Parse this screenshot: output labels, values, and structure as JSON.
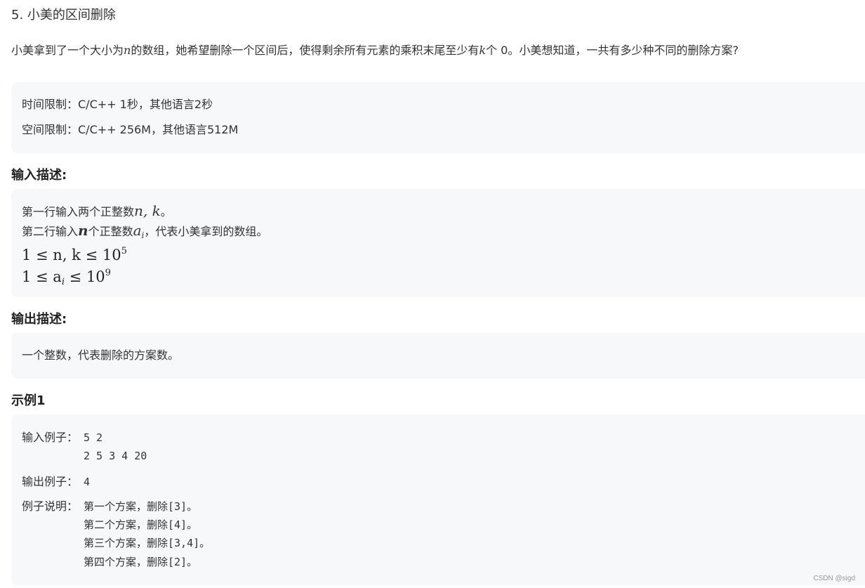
{
  "problem": {
    "title": "5. 小美的区间删除",
    "description": {
      "part1": "小美拿到了一个大小为",
      "var_n": "n",
      "part2": "的数组，她希望删除一个区间后，使得剩余所有元素的乘积末尾至少有",
      "var_k": "k",
      "part3": "个 0。小美想知道，一共有多少种不同的删除方案?"
    }
  },
  "limits": {
    "time": "时间限制：C/C++ 1秒，其他语言2秒",
    "memory": "空间限制：C/C++ 256M，其他语言512M"
  },
  "input_section": {
    "heading": "输入描述:",
    "line1_text": "第一行输入两个正整数",
    "line1_math": "n, k",
    "line1_end": "。",
    "line2_text": "第二行输入",
    "line2_math_n": "n",
    "line2_mid": "个正整数",
    "line2_math_a": "a",
    "line2_sub": "i",
    "line2_end": "，代表小美拿到的数组。",
    "constraint1": "1 ≤ n, k ≤ 10",
    "constraint1_exp": "5",
    "constraint2_left": "1 ≤ a",
    "constraint2_sub": "i",
    "constraint2_right": " ≤ 10",
    "constraint2_exp": "9"
  },
  "output_section": {
    "heading": "输出描述:",
    "text": "一个整数，代表删除的方案数。"
  },
  "example": {
    "heading": "示例1",
    "input_label": "输入例子：",
    "input_lines": [
      "5 2",
      "2 5 3 4 20"
    ],
    "output_label": "输出例子：",
    "output_value": "4",
    "explain_label": "例子说明：",
    "explain_lines": [
      "第一个方案，删除[3]。",
      "第二个方案，删除[4]。",
      "第三个方案，删除[3,4]。",
      "第四个方案，删除[2]。"
    ]
  },
  "watermark": "CSDN @sigd"
}
